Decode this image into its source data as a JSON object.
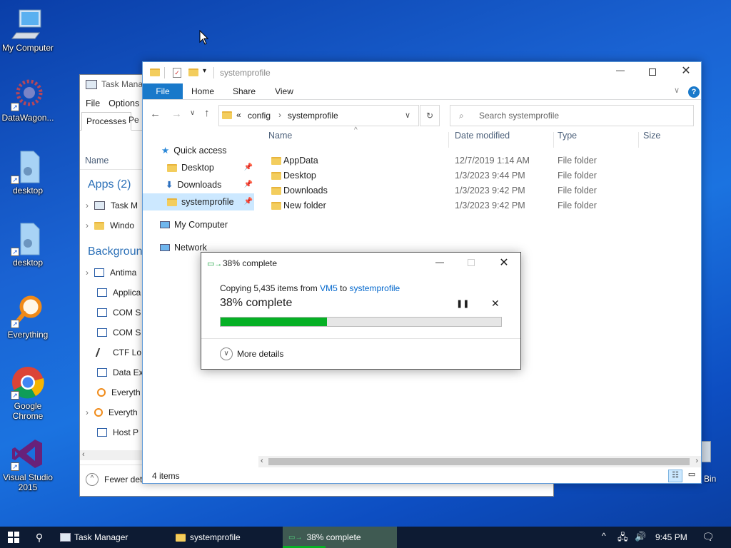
{
  "desktop": {
    "icons": [
      {
        "label": "My Computer"
      },
      {
        "label": "DataWagon..."
      },
      {
        "label": "desktop"
      },
      {
        "label": "desktop"
      },
      {
        "label": "Everything"
      },
      {
        "label": "Google Chrome"
      },
      {
        "label": "Visual Studio 2015"
      },
      {
        "label": "Bin"
      }
    ]
  },
  "task_manager": {
    "title": "Task Manager",
    "menu": [
      "File",
      "Options"
    ],
    "tabs": [
      "Processes",
      "Pe"
    ],
    "name_header": "Name",
    "apps_group": "Apps (2)",
    "apps": [
      "Task M",
      "Windo"
    ],
    "background_group": "Backgroun",
    "background": [
      "Antima",
      "Applica",
      "COM S",
      "COM S",
      "CTF Lo",
      "Data Ex",
      "Everyth",
      "Everyth",
      "Host P"
    ],
    "fewer_details": "Fewer det"
  },
  "explorer": {
    "title": "systemprofile",
    "ribbon_tabs": [
      "File",
      "Home",
      "Share",
      "View"
    ],
    "breadcrumb": [
      "config",
      "systemprofile"
    ],
    "breadcrumb_prefix": "«",
    "search_placeholder": "Search systemprofile",
    "nav": {
      "quick_access": "Quick access",
      "items": [
        "Desktop",
        "Downloads",
        "systemprofile"
      ],
      "my_computer": "My Computer",
      "network": "Network"
    },
    "columns": [
      "Name",
      "Date modified",
      "Type",
      "Size"
    ],
    "files": [
      {
        "name": "AppData",
        "date": "12/7/2019 1:14 AM",
        "type": "File folder"
      },
      {
        "name": "Desktop",
        "date": "1/3/2023 9:44 PM",
        "type": "File folder"
      },
      {
        "name": "Downloads",
        "date": "1/3/2023 9:42 PM",
        "type": "File folder"
      },
      {
        "name": "New folder",
        "date": "1/3/2023 9:42 PM",
        "type": "File folder"
      }
    ],
    "status": "4 items"
  },
  "copy_dialog": {
    "title": "38% complete",
    "copying_prefix": "Copying 5,435 items from",
    "source": "VM5",
    "to": "to",
    "destination": "systemprofile",
    "percent_label": "38% complete",
    "progress": 0.38,
    "more_details": "More details"
  },
  "taskbar": {
    "items": [
      "Task Manager",
      "systemprofile",
      "38% complete"
    ],
    "time": "9:45 PM"
  },
  "colors": {
    "accent": "#0063b1",
    "progress_green": "#06b025",
    "link": "#0066cc"
  }
}
